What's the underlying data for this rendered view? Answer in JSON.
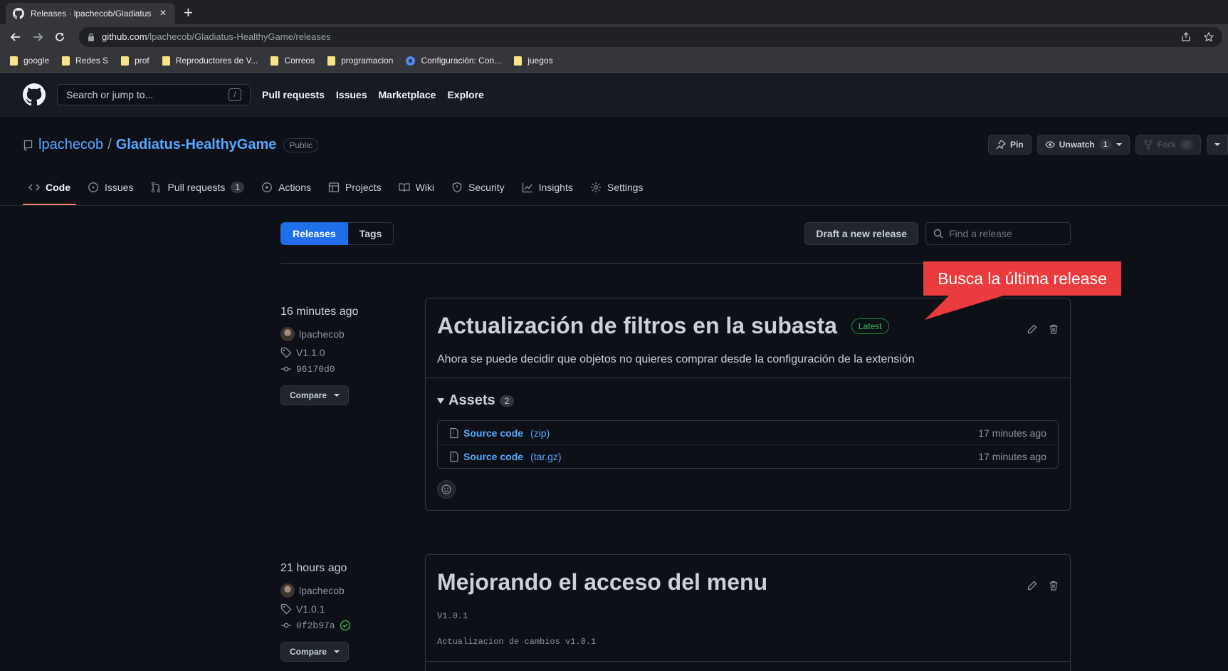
{
  "browser": {
    "tab_title": "Releases · lpachecob/Gladiatus-H",
    "url_host": "github.com",
    "url_path": "/lpachecob/Gladiatus-HealthyGame/releases",
    "bookmarks": [
      {
        "label": "google",
        "icon": "folder-icon"
      },
      {
        "label": "Redes S",
        "icon": "folder-icon"
      },
      {
        "label": "prof",
        "icon": "folder-icon"
      },
      {
        "label": "Reproductores de V...",
        "icon": "folder-icon"
      },
      {
        "label": "Correos",
        "icon": "folder-icon"
      },
      {
        "label": "programacion",
        "icon": "folder-icon"
      },
      {
        "label": "Configuración: Con...",
        "icon": "gear-icon"
      },
      {
        "label": "juegos",
        "icon": "folder-icon"
      }
    ]
  },
  "github": {
    "search_placeholder": "Search or jump to...",
    "search_shortcut": "/",
    "nav": [
      "Pull requests",
      "Issues",
      "Marketplace",
      "Explore"
    ]
  },
  "repo": {
    "owner": "lpachecob",
    "separator": "/",
    "name": "Gladiatus-HealthyGame",
    "visibility": "Public",
    "pin_label": "Pin",
    "unwatch_label": "Unwatch",
    "unwatch_count": "1",
    "fork_label": "Fork",
    "fork_count": "0",
    "tabs": [
      {
        "label": "Code",
        "icon": "code-icon",
        "active": true
      },
      {
        "label": "Issues",
        "icon": "issue-icon"
      },
      {
        "label": "Pull requests",
        "icon": "pull-request-icon",
        "counter": "1"
      },
      {
        "label": "Actions",
        "icon": "play-icon"
      },
      {
        "label": "Projects",
        "icon": "table-icon"
      },
      {
        "label": "Wiki",
        "icon": "book-icon"
      },
      {
        "label": "Security",
        "icon": "shield-icon"
      },
      {
        "label": "Insights",
        "icon": "graph-icon"
      },
      {
        "label": "Settings",
        "icon": "gear-icon"
      }
    ]
  },
  "releases_page": {
    "tab_releases": "Releases",
    "tab_tags": "Tags",
    "draft_button": "Draft a new release",
    "find_placeholder": "Find a release",
    "annotation": "Busca la última release"
  },
  "releases": [
    {
      "when": "16 minutes ago",
      "author": "lpachecob",
      "tag": "V1.1.0",
      "commit": "96170d0",
      "compare_label": "Compare",
      "title": "Actualización de filtros en la subasta",
      "latest_label": "Latest",
      "description": "Ahora se puede decidir que objetos no quieres comprar desde la configuración de la extensión",
      "assets_title": "Assets",
      "assets_count": "2",
      "assets": [
        {
          "label": "Source code",
          "ext": "(zip)",
          "age": "17 minutes ago"
        },
        {
          "label": "Source code",
          "ext": "(tar.gz)",
          "age": "17 minutes ago"
        }
      ]
    },
    {
      "when": "21 hours ago",
      "author": "lpachecob",
      "tag": "V1.0.1",
      "commit": "0f2b97a",
      "compare_label": "Compare",
      "title": "Mejorando el acceso del menu",
      "desc_line1": "V1.0.1",
      "desc_line2": "Actualizacion de cambios v1.0.1"
    }
  ]
}
